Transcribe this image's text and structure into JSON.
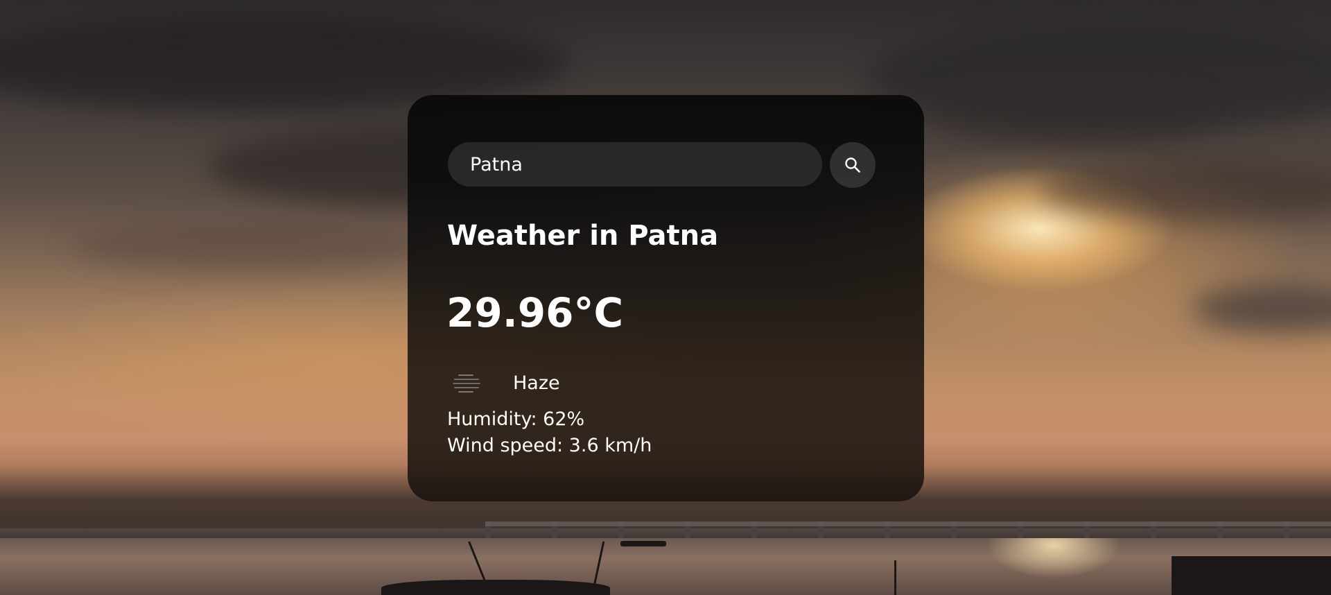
{
  "search": {
    "value": "Patna",
    "button_icon": "search-icon"
  },
  "weather": {
    "title": "Weather in Patna",
    "temperature": "29.96°C",
    "condition_icon": "haze-icon",
    "condition": "Haze",
    "humidity": "Humidity: 62%",
    "wind": "Wind speed: 3.6 km/h"
  },
  "colors": {
    "card_background": "#0c0c0c",
    "text": "#ffffff",
    "search_field": "#3e3e3e"
  }
}
